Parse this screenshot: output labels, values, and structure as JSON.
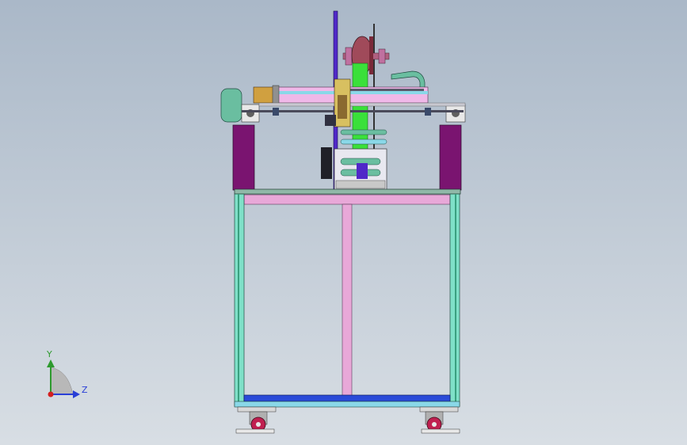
{
  "viewport": {
    "background_top": "#aab8c8",
    "background_bottom": "#d8dee4"
  },
  "triad": {
    "y_label": "Y",
    "z_label": "Z",
    "y_color": "#2e9a2e",
    "z_color": "#2a3fd6",
    "origin_color": "#d42020"
  },
  "model": {
    "frame_teal": "#7fe0c8",
    "frame_pink": "#e8a8d8",
    "frame_blue": "#2a4bd8",
    "post_purple": "#7a1470",
    "spool_red": "#a04a5a",
    "belt_green": "#3ae03a",
    "motor_green": "#6abea0",
    "gantry_pink": "#f0b8e8",
    "gantry_cyan": "#8ad8e8",
    "column_blue": "#5028c8",
    "caster_red": "#c02050"
  }
}
